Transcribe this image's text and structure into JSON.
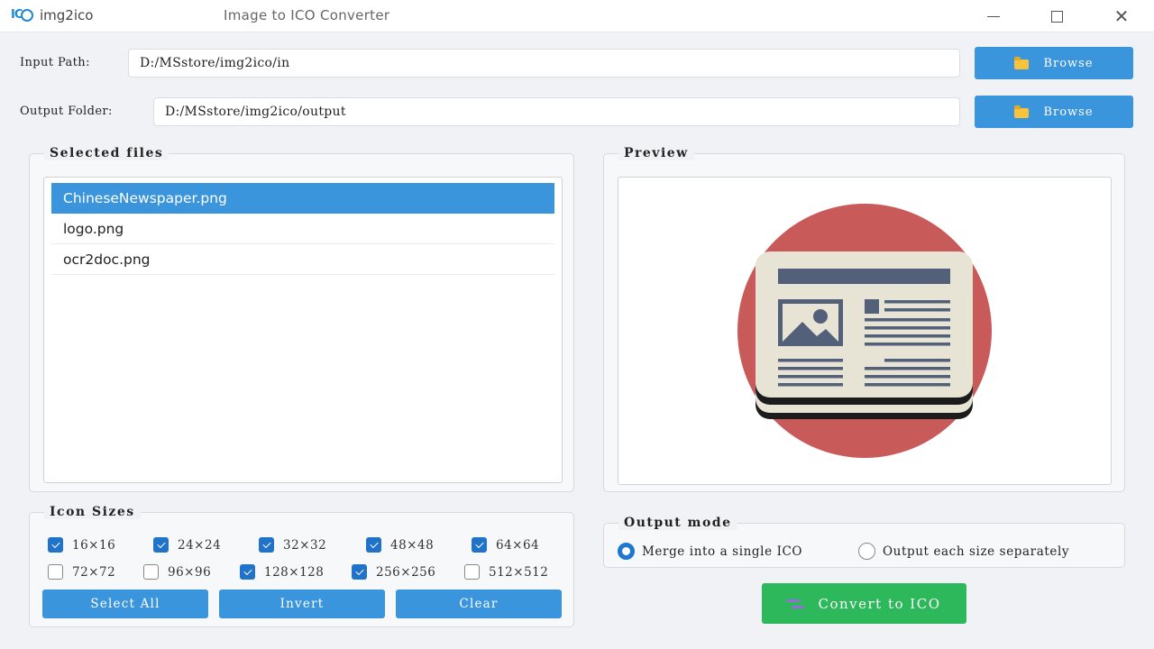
{
  "app": {
    "name": "img2ico",
    "window_title": "Image to ICO Converter"
  },
  "paths": {
    "input_label": "Input Path:",
    "input_value": "D:/MSstore/img2ico/in",
    "output_label": "Output Folder:",
    "output_value": "D:/MSstore/img2ico/output",
    "browse_label": "Browse"
  },
  "selected_files": {
    "title": "Selected files",
    "items": [
      {
        "name": "ChineseNewspaper.png",
        "selected": true
      },
      {
        "name": "logo.png",
        "selected": false
      },
      {
        "name": "ocr2doc.png",
        "selected": false
      }
    ]
  },
  "preview": {
    "title": "Preview",
    "image_icon": "newspaper-icon"
  },
  "icon_sizes": {
    "title": "Icon Sizes",
    "items": [
      {
        "label": "16×16",
        "checked": true
      },
      {
        "label": "24×24",
        "checked": true
      },
      {
        "label": "32×32",
        "checked": true
      },
      {
        "label": "48×48",
        "checked": true
      },
      {
        "label": "64×64",
        "checked": true
      },
      {
        "label": "72×72",
        "checked": false
      },
      {
        "label": "96×96",
        "checked": false
      },
      {
        "label": "128×128",
        "checked": true
      },
      {
        "label": "256×256",
        "checked": true
      },
      {
        "label": "512×512",
        "checked": false
      }
    ],
    "select_all_label": "Select All",
    "invert_label": "Invert",
    "clear_label": "Clear"
  },
  "output_mode": {
    "title": "Output mode",
    "merge_label": "Merge into a single ICO",
    "separate_label": "Output each size separately",
    "selected": "merge"
  },
  "convert": {
    "label": "Convert to ICO"
  },
  "colors": {
    "accent": "#3a95dc",
    "checkbox": "#2172c9",
    "convert": "#2eb85c",
    "preview_circle": "#c85a5a"
  }
}
